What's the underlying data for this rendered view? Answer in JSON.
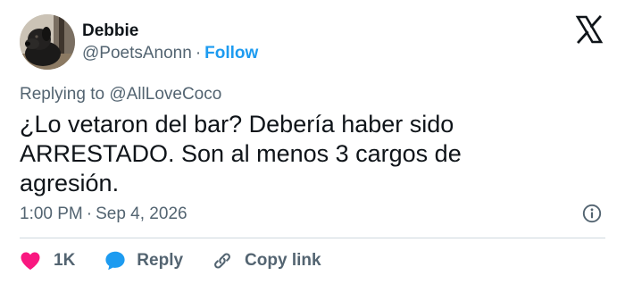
{
  "author": {
    "name": "Debbie",
    "handle": "@PoetsAnonn",
    "separator": "·",
    "follow_label": "Follow"
  },
  "reply_to": {
    "prefix": "Replying to",
    "mention": "@AllLoveCoco"
  },
  "tweet": {
    "text": "¿Lo vetaron del bar? Debería haber sido\nARRESTADO. Son al menos 3 cargos de\nagresión.",
    "time": "1:00 PM",
    "separator": "·",
    "date": "Sep 4, 2026"
  },
  "actions": {
    "like_count": "1K",
    "reply_label": "Reply",
    "copy_label": "Copy link"
  },
  "icons": {
    "brand": "x-logo-icon",
    "info": "info-icon",
    "like": "heart-icon",
    "reply": "speech-bubble-icon",
    "copy": "link-icon"
  },
  "colors": {
    "text": "#0f1419",
    "secondary": "#536471",
    "link": "#1d9bf0",
    "like": "#f91880",
    "divider": "#cfd9de"
  }
}
